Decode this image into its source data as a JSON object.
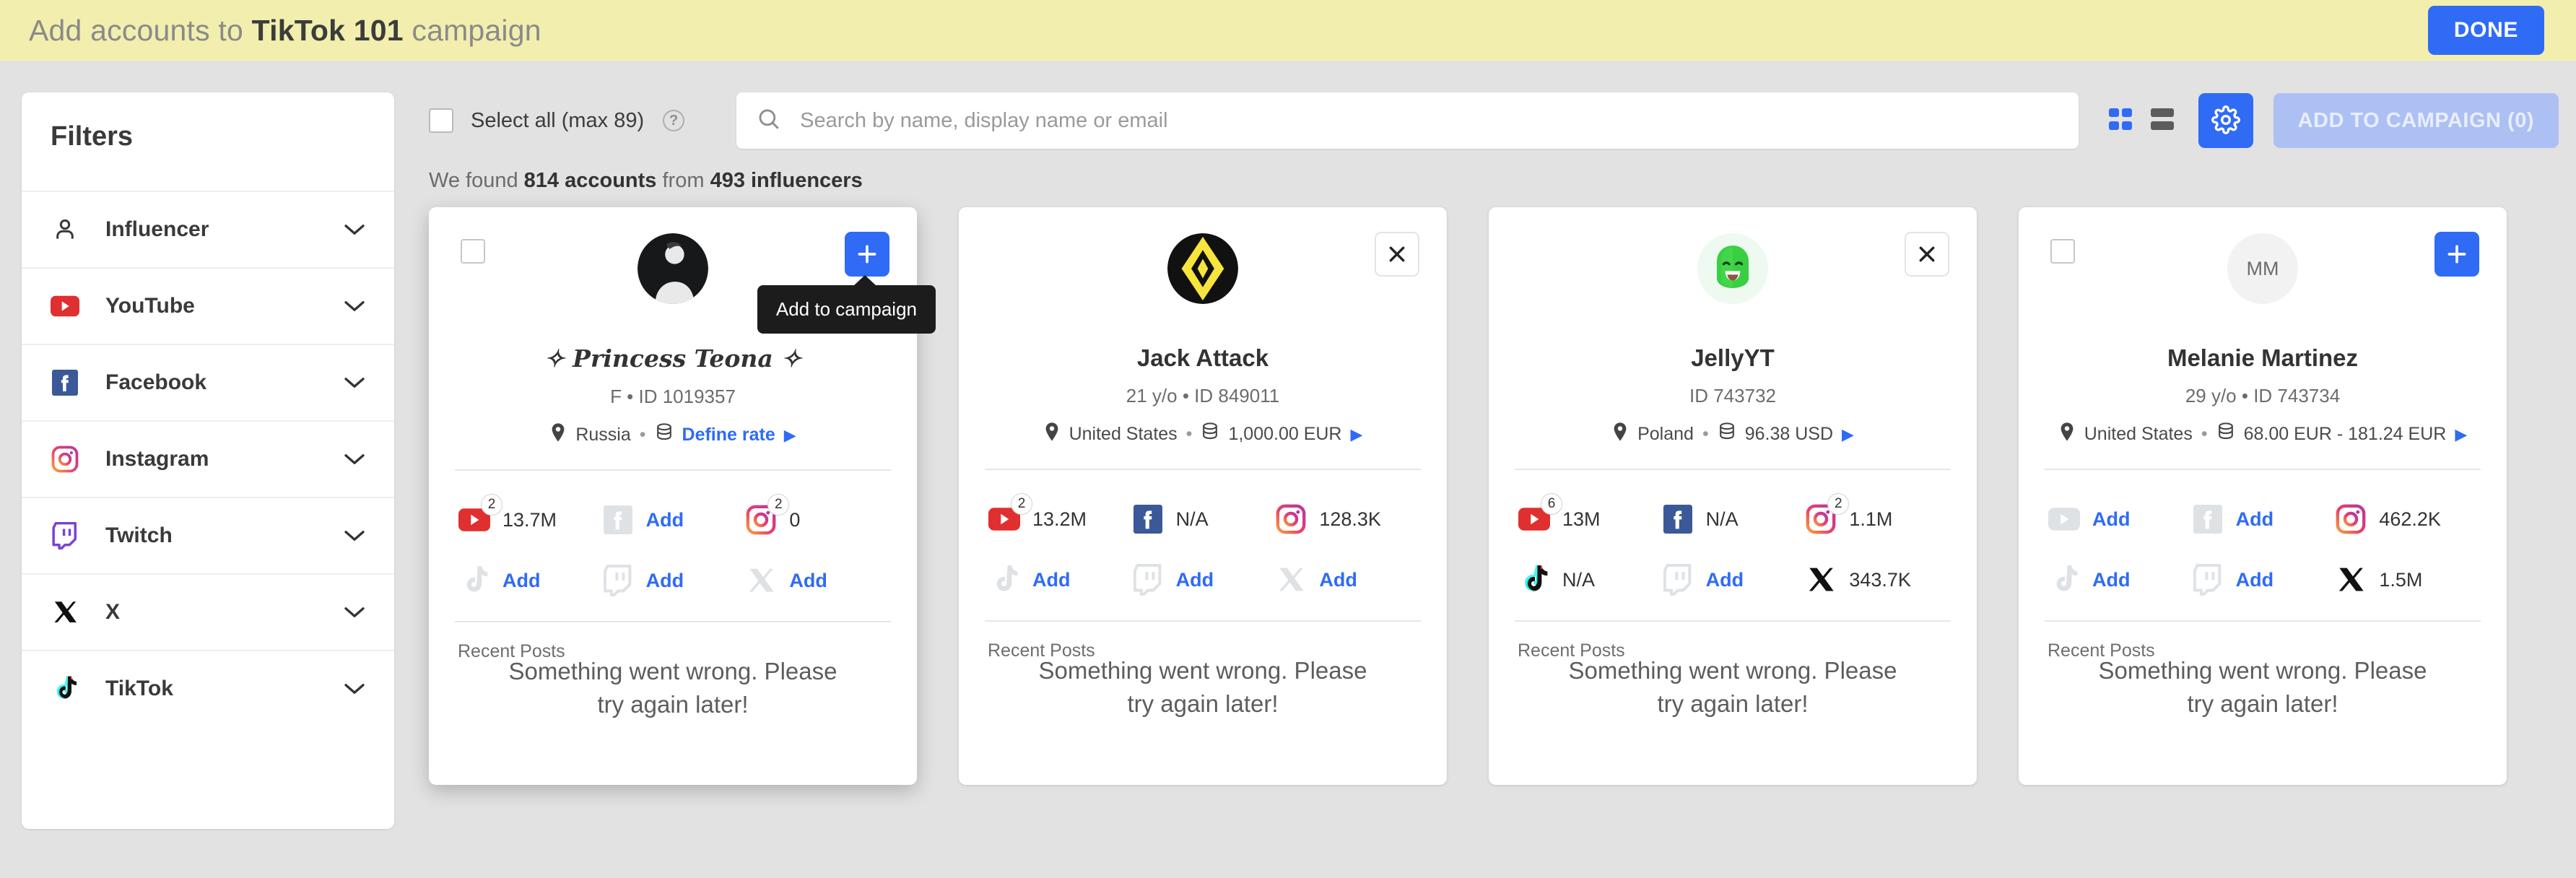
{
  "header": {
    "title_prefix": "Add accounts to ",
    "title_strong": "TikTok 101",
    "title_suffix": " campaign",
    "done_label": "DONE"
  },
  "sidebar": {
    "title": "Filters",
    "items": [
      {
        "label": "Influencer",
        "icon": "person-icon"
      },
      {
        "label": "YouTube",
        "icon": "youtube-icon"
      },
      {
        "label": "Facebook",
        "icon": "facebook-icon"
      },
      {
        "label": "Instagram",
        "icon": "instagram-icon"
      },
      {
        "label": "Twitch",
        "icon": "twitch-icon"
      },
      {
        "label": "X",
        "icon": "x-icon"
      },
      {
        "label": "TikTok",
        "icon": "tiktok-icon"
      }
    ]
  },
  "toolbar": {
    "select_all_label": "Select all (max 89)",
    "help_glyph": "?",
    "search_placeholder": "Search by name, display name or email",
    "search_value": "",
    "grid_view_label": "grid-view",
    "list_view_label": "list-view",
    "settings_label": "settings",
    "add_to_campaign_label": "ADD TO CAMPAIGN (0)"
  },
  "results": {
    "prefix": "We found ",
    "accounts": "814 accounts",
    "middle": " from ",
    "influencers": "493 influencers"
  },
  "tooltip": {
    "text": "Add to campaign"
  },
  "posts": {
    "recent_label": "Recent Posts",
    "error_text": "Something went wrong. Please try again later!"
  },
  "accent": {
    "blue": "#2f6bf5",
    "header_bg": "#f2eeae",
    "page_bg": "#e2e2e2"
  },
  "cards": [
    {
      "name": "✧ Princess Teona ✧",
      "name_style": "script",
      "meta": "F • ID 1019357",
      "country": "Russia",
      "rate": "Define rate",
      "rate_is_link": true,
      "checkbox": true,
      "action": "add",
      "avatar_type": "photo",
      "avatar_initials": "",
      "tooltip": true,
      "hovered": true,
      "socials": [
        {
          "network": "youtube",
          "value": "13.7M",
          "badge": "2",
          "muted": false
        },
        {
          "network": "facebook",
          "value": "Add",
          "badge": "",
          "muted": true
        },
        {
          "network": "instagram",
          "value": "0",
          "badge": "2",
          "muted": false
        },
        {
          "network": "tiktok",
          "value": "Add",
          "badge": "",
          "muted": true
        },
        {
          "network": "twitch",
          "value": "Add",
          "badge": "",
          "muted": true
        },
        {
          "network": "x",
          "value": "Add",
          "badge": "",
          "muted": true
        }
      ]
    },
    {
      "name": "Jack Attack",
      "name_style": "normal",
      "meta": "21 y/o • ID 849011",
      "country": "United States",
      "rate": "1,000.00 EUR",
      "rate_is_link": false,
      "checkbox": false,
      "action": "remove",
      "avatar_type": "jack",
      "avatar_initials": "",
      "tooltip": false,
      "hovered": false,
      "socials": [
        {
          "network": "youtube",
          "value": "13.2M",
          "badge": "2",
          "muted": false
        },
        {
          "network": "facebook",
          "value": "N/A",
          "badge": "",
          "muted": false
        },
        {
          "network": "instagram",
          "value": "128.3K",
          "badge": "",
          "muted": false
        },
        {
          "network": "tiktok",
          "value": "Add",
          "badge": "",
          "muted": true
        },
        {
          "network": "twitch",
          "value": "Add",
          "badge": "",
          "muted": true
        },
        {
          "network": "x",
          "value": "Add",
          "badge": "",
          "muted": true
        }
      ]
    },
    {
      "name": "JellyYT",
      "name_style": "normal",
      "meta": "ID 743732",
      "country": "Poland",
      "rate": "96.38 USD",
      "rate_is_link": false,
      "checkbox": false,
      "action": "remove",
      "avatar_type": "jelly",
      "avatar_initials": "",
      "tooltip": false,
      "hovered": false,
      "socials": [
        {
          "network": "youtube",
          "value": "13M",
          "badge": "6",
          "muted": false
        },
        {
          "network": "facebook",
          "value": "N/A",
          "badge": "",
          "muted": false
        },
        {
          "network": "instagram",
          "value": "1.1M",
          "badge": "2",
          "muted": false
        },
        {
          "network": "tiktok",
          "value": "N/A",
          "badge": "",
          "muted": false
        },
        {
          "network": "twitch",
          "value": "Add",
          "badge": "",
          "muted": true
        },
        {
          "network": "x",
          "value": "343.7K",
          "badge": "",
          "muted": false
        }
      ]
    },
    {
      "name": "Melanie Martinez",
      "name_style": "normal",
      "meta": "29 y/o • ID 743734",
      "country": "United States",
      "rate": "68.00 EUR - 181.24 EUR",
      "rate_is_link": false,
      "checkbox": true,
      "action": "add",
      "avatar_type": "initials",
      "avatar_initials": "MM",
      "tooltip": false,
      "hovered": false,
      "socials": [
        {
          "network": "youtube",
          "value": "Add",
          "badge": "",
          "muted": true
        },
        {
          "network": "facebook",
          "value": "Add",
          "badge": "",
          "muted": true
        },
        {
          "network": "instagram",
          "value": "462.2K",
          "badge": "",
          "muted": false
        },
        {
          "network": "tiktok",
          "value": "Add",
          "badge": "",
          "muted": true
        },
        {
          "network": "twitch",
          "value": "Add",
          "badge": "",
          "muted": true
        },
        {
          "network": "x",
          "value": "1.5M",
          "badge": "",
          "muted": false
        }
      ]
    }
  ]
}
